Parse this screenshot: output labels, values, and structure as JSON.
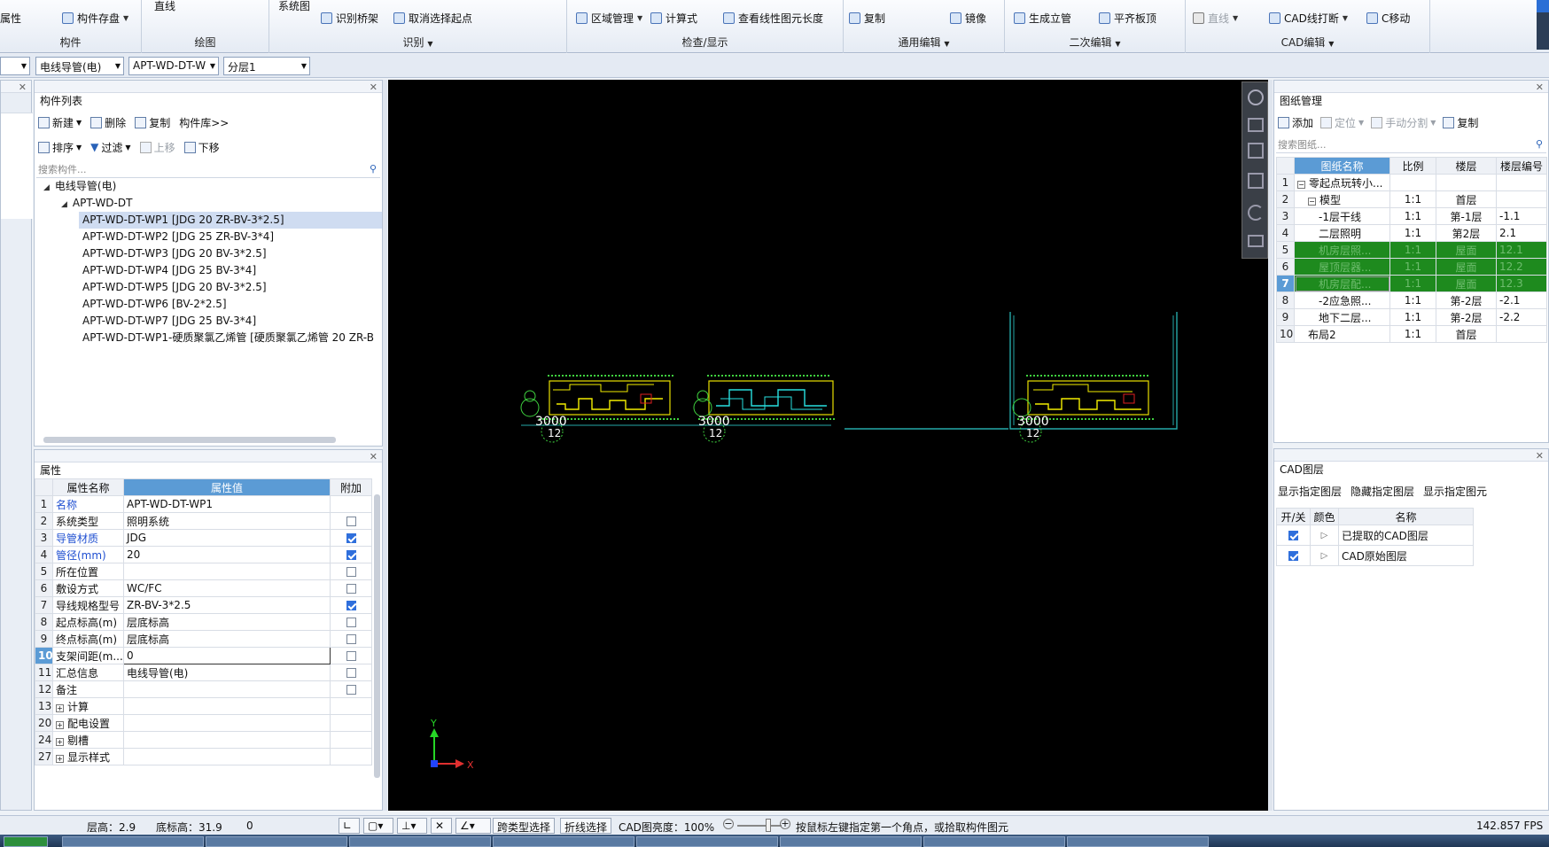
{
  "ribbon": {
    "groups": [
      {
        "label": "构件",
        "buttons": [
          {
            "label": "属性",
            "dropdown": false
          },
          {
            "label": "构件存盘",
            "dropdown": true
          }
        ]
      },
      {
        "label": "绘图",
        "buttons": [
          {
            "label": "直线",
            "dropdown": false
          }
        ]
      },
      {
        "label": "识别",
        "buttons": [
          {
            "label": "系统图",
            "dropdown": false
          },
          {
            "label": "识别桥架",
            "dropdown": false
          },
          {
            "label": "取消选择起点",
            "dropdown": false
          }
        ]
      },
      {
        "label": "检查/显示",
        "buttons": [
          {
            "label": "区域管理",
            "dropdown": true
          },
          {
            "label": "计算式",
            "dropdown": false
          },
          {
            "label": "查看线性图元长度",
            "dropdown": false
          }
        ]
      },
      {
        "label": "通用编辑",
        "buttons": [
          {
            "label": "复制",
            "dropdown": false
          },
          {
            "label": "镜像",
            "dropdown": false
          }
        ]
      },
      {
        "label": "二次编辑",
        "buttons": [
          {
            "label": "生成立管",
            "dropdown": false
          },
          {
            "label": "平齐板顶",
            "dropdown": false
          }
        ]
      },
      {
        "label": "CAD编辑",
        "buttons": [
          {
            "label": "直线",
            "dropdown": true
          },
          {
            "label": "CAD线打断",
            "dropdown": true
          },
          {
            "label": "C移动",
            "dropdown": false
          }
        ]
      }
    ]
  },
  "toolbar": {
    "combos": [
      "",
      "电线导管(电)",
      "APT-WD-DT-W",
      "分层1"
    ]
  },
  "component_list": {
    "title": "构件列表",
    "toolbar1": {
      "new": "新建",
      "delete": "删除",
      "copy": "复制",
      "library": "构件库>>"
    },
    "toolbar2": {
      "sort": "排序",
      "filter": "过滤",
      "up": "上移",
      "down": "下移"
    },
    "search_placeholder": "搜索构件...",
    "root": "电线导管(电)",
    "group": "APT-WD-DT",
    "items": [
      "APT-WD-DT-WP1 [JDG 20 ZR-BV-3*2.5]",
      "APT-WD-DT-WP2 [JDG 25 ZR-BV-3*4]",
      "APT-WD-DT-WP3 [JDG 20 BV-3*2.5]",
      "APT-WD-DT-WP4 [JDG 25 BV-3*4]",
      "APT-WD-DT-WP5 [JDG 20 BV-3*2.5]",
      "APT-WD-DT-WP6 [BV-2*2.5]",
      "APT-WD-DT-WP7 [JDG 25 BV-3*4]",
      "APT-WD-DT-WP1-硬质聚氯乙烯管 [硬质聚氯乙烯管 20 ZR-B"
    ],
    "selected_index": 0
  },
  "properties": {
    "title": "属性",
    "headers": {
      "name": "属性名称",
      "value": "属性值",
      "extra": "附加"
    },
    "rows": [
      {
        "n": "1",
        "name": "名称",
        "value": "APT-WD-DT-WP1",
        "blue": true,
        "check": null
      },
      {
        "n": "2",
        "name": "系统类型",
        "value": "照明系统",
        "blue": false,
        "check": false
      },
      {
        "n": "3",
        "name": "导管材质",
        "value": "JDG",
        "blue": true,
        "check": true
      },
      {
        "n": "4",
        "name": "管径(mm)",
        "value": "20",
        "blue": true,
        "check": true
      },
      {
        "n": "5",
        "name": "所在位置",
        "value": "",
        "blue": false,
        "check": false
      },
      {
        "n": "6",
        "name": "敷设方式",
        "value": "WC/FC",
        "blue": false,
        "check": false
      },
      {
        "n": "7",
        "name": "导线规格型号",
        "value": "ZR-BV-3*2.5",
        "blue": false,
        "check": true
      },
      {
        "n": "8",
        "name": "起点标高(m)",
        "value": "层底标高",
        "blue": false,
        "check": false
      },
      {
        "n": "9",
        "name": "终点标高(m)",
        "value": "层底标高",
        "blue": false,
        "check": false
      },
      {
        "n": "10",
        "name": "支架间距(m...",
        "value": "0",
        "blue": false,
        "check": false,
        "active": true
      },
      {
        "n": "11",
        "name": "汇总信息",
        "value": "电线导管(电)",
        "blue": false,
        "check": false
      },
      {
        "n": "12",
        "name": "备注",
        "value": "",
        "blue": false,
        "check": false
      },
      {
        "n": "13",
        "name": "计算",
        "value": "",
        "blue": false,
        "check": null,
        "expand": true
      },
      {
        "n": "20",
        "name": "配电设置",
        "value": "",
        "blue": false,
        "check": null,
        "expand": true
      },
      {
        "n": "24",
        "name": "剔槽",
        "value": "",
        "blue": false,
        "check": null,
        "expand": true
      },
      {
        "n": "27",
        "name": "显示样式",
        "value": "",
        "blue": false,
        "check": null,
        "expand": true
      }
    ]
  },
  "canvas": {
    "labels": [
      "3000",
      "3000",
      "3000"
    ],
    "numbers": [
      "12",
      "12",
      "12"
    ],
    "axis_y": "Y",
    "axis_x": "X"
  },
  "drawing_mgmt": {
    "title": "图纸管理",
    "toolbar": {
      "add": "添加",
      "locate": "定位",
      "split": "手动分割",
      "copy": "复制"
    },
    "search_placeholder": "搜索图纸...",
    "headers": {
      "name": "图纸名称",
      "scale": "比例",
      "floor": "楼层",
      "floor_no": "楼层编号"
    },
    "rows": [
      {
        "n": "1",
        "name": "零起点玩转小...",
        "scale": "",
        "floor": "",
        "no": "",
        "level": 0,
        "toggle": "-"
      },
      {
        "n": "2",
        "name": "模型",
        "scale": "1:1",
        "floor": "首层",
        "no": "",
        "level": 1,
        "toggle": "-"
      },
      {
        "n": "3",
        "name": "-1层干线",
        "scale": "1:1",
        "floor": "第-1层",
        "no": "-1.1",
        "level": 2
      },
      {
        "n": "4",
        "name": "二层照明",
        "scale": "1:1",
        "floor": "第2层",
        "no": "2.1",
        "level": 2
      },
      {
        "n": "5",
        "name": "机房层照...",
        "scale": "1:1",
        "floor": "屋面",
        "no": "12.1",
        "level": 2,
        "green": true
      },
      {
        "n": "6",
        "name": "屋顶层器...",
        "scale": "1:1",
        "floor": "屋面",
        "no": "12.2",
        "level": 2,
        "green": true
      },
      {
        "n": "7",
        "name": "机房层配...",
        "scale": "1:1",
        "floor": "屋面",
        "no": "12.3",
        "level": 2,
        "green": true,
        "selected": true
      },
      {
        "n": "8",
        "name": "-2应急照...",
        "scale": "1:1",
        "floor": "第-2层",
        "no": "-2.1",
        "level": 2
      },
      {
        "n": "9",
        "name": "地下二层...",
        "scale": "1:1",
        "floor": "第-2层",
        "no": "-2.2",
        "level": 2
      },
      {
        "n": "10",
        "name": "布局2",
        "scale": "1:1",
        "floor": "首层",
        "no": "",
        "level": 1
      }
    ]
  },
  "cad_layers": {
    "title": "CAD图层",
    "toolbar": {
      "show_layer": "显示指定图层",
      "hide_layer": "隐藏指定图层",
      "show_elem": "显示指定图元"
    },
    "headers": {
      "toggle": "开/关",
      "color": "颜色",
      "name": "名称"
    },
    "rows": [
      {
        "on": true,
        "name": "已提取的CAD图层"
      },
      {
        "on": true,
        "name": "CAD原始图层"
      }
    ]
  },
  "status": {
    "floor_height": "层高：2.9",
    "bottom_elev": "底标高：31.9",
    "count": "0",
    "cross_select": "跨类型选择",
    "polyline_select": "折线选择",
    "cad_brightness": "CAD图亮度：100%",
    "hint": "按鼠标左键指定第一个角点，或拾取构件图元",
    "fps": "142.857 FPS"
  }
}
